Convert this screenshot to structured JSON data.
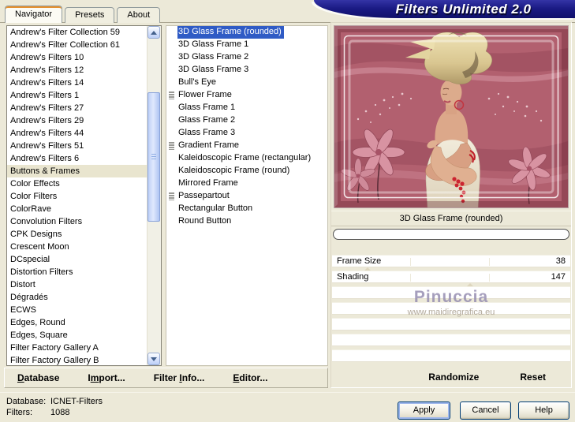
{
  "window": {
    "title": "Filters Unlimited 2.0"
  },
  "tabs": [
    {
      "label": "Navigator",
      "active": true
    },
    {
      "label": "Presets",
      "active": false
    },
    {
      "label": "About",
      "active": false
    }
  ],
  "category_list": {
    "selected_index": 11,
    "items": [
      "Andrew's Filter Collection 59",
      "Andrew's Filter Collection 61",
      "Andrew's Filters 10",
      "Andrew's Filters 12",
      "Andrew's Filters 14",
      "Andrew's Filters 1",
      "Andrew's Filters 27",
      "Andrew's Filters 29",
      "Andrew's Filters 44",
      "Andrew's Filters 51",
      "Andrew's Filters 6",
      "Buttons & Frames",
      "Color Effects",
      "Color Filters",
      "ColorRave",
      "Convolution Filters",
      "CPK Designs",
      "Crescent Moon",
      "DCspecial",
      "Distortion Filters",
      "Distort",
      "Dégradés",
      "ECWS",
      "Edges, Round",
      "Edges, Square",
      "Filter Factory Gallery A",
      "Filter Factory Gallery B"
    ]
  },
  "filter_list": {
    "items": [
      {
        "label": "3D Glass Frame (rounded)",
        "selected": true,
        "marker": false
      },
      {
        "label": "3D Glass Frame 1",
        "selected": false,
        "marker": false
      },
      {
        "label": "3D Glass Frame 2",
        "selected": false,
        "marker": false
      },
      {
        "label": "3D Glass Frame 3",
        "selected": false,
        "marker": false
      },
      {
        "label": "Bull's Eye",
        "selected": false,
        "marker": false
      },
      {
        "label": "Flower Frame",
        "selected": false,
        "marker": true
      },
      {
        "label": "Glass Frame 1",
        "selected": false,
        "marker": false
      },
      {
        "label": "Glass Frame 2",
        "selected": false,
        "marker": false
      },
      {
        "label": "Glass Frame 3",
        "selected": false,
        "marker": false
      },
      {
        "label": "Gradient Frame",
        "selected": false,
        "marker": true
      },
      {
        "label": "Kaleidoscopic Frame (rectangular)",
        "selected": false,
        "marker": false
      },
      {
        "label": "Kaleidoscopic Frame (round)",
        "selected": false,
        "marker": false
      },
      {
        "label": "Mirrored Frame",
        "selected": false,
        "marker": false
      },
      {
        "label": "Passepartout",
        "selected": false,
        "marker": true
      },
      {
        "label": "Rectangular Button",
        "selected": false,
        "marker": false
      },
      {
        "label": "Round Button",
        "selected": false,
        "marker": false
      }
    ]
  },
  "preview": {
    "caption": "3D Glass Frame (rounded)",
    "watermark": "Pinuccia",
    "watermark_url": "www.maidiregrafica.eu"
  },
  "controls": {
    "params": [
      {
        "label": "Frame Size",
        "value": "38",
        "marker_pct": 15
      },
      {
        "label": "Shading",
        "value": "147",
        "marker_pct": 58
      }
    ],
    "empty_rows": 5
  },
  "toolbar": {
    "items": [
      {
        "id": "database",
        "pre": "",
        "key": "D",
        "post": "atabase"
      },
      {
        "id": "import",
        "pre": "I",
        "key": "m",
        "post": "port..."
      },
      {
        "id": "filter-info",
        "pre": "Filter ",
        "key": "I",
        "post": "nfo..."
      },
      {
        "id": "editor",
        "pre": "",
        "key": "E",
        "post": "ditor..."
      }
    ]
  },
  "actions": {
    "randomize": "Randomize",
    "reset": "Reset"
  },
  "status": {
    "database_label": "Database:",
    "database_value": "ICNET-Filters",
    "filters_label": "Filters:",
    "filters_value": "1088"
  },
  "buttons": {
    "apply": "Apply",
    "cancel": "Cancel",
    "help": "Help"
  },
  "colors": {
    "banner_navy": "#1b1b85",
    "selection_blue": "#2f5bc5",
    "active_tab_orange": "#e5902e",
    "dialog_beige": "#ece9d8",
    "preview_rose": "#b2606f"
  }
}
